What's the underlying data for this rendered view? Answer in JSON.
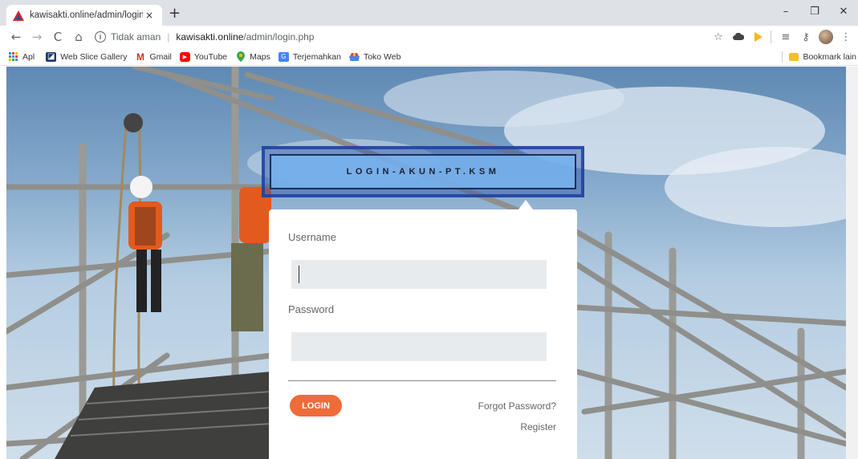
{
  "browser": {
    "tab_title": "kawisakti.online/admin/login.php",
    "tab_close": "×",
    "new_tab": "+",
    "window": {
      "minimize": "–",
      "maximize": "❐",
      "close": "✕"
    },
    "nav": {
      "back": "←",
      "forward": "→",
      "reload": "C",
      "home": "⌂"
    },
    "security_info": "i",
    "security_label": "Tidak aman",
    "url_host": "kawisakti.online",
    "url_path": "/admin/login.php",
    "bookmarks": [
      {
        "label": "Apl",
        "icon": "apps-grid-icon"
      },
      {
        "label": "Web Slice Gallery",
        "icon": "web-slice-icon"
      },
      {
        "label": "Gmail",
        "icon": "gmail-icon"
      },
      {
        "label": "YouTube",
        "icon": "youtube-icon"
      },
      {
        "label": "Maps",
        "icon": "maps-pin-icon"
      },
      {
        "label": "Terjemahkan",
        "icon": "translate-icon"
      },
      {
        "label": "Toko Web",
        "icon": "webstore-icon"
      }
    ],
    "bookmark_other": "Bookmark lain"
  },
  "page": {
    "banner_title": "LOGIN-AKUN-PT.KSM",
    "form": {
      "username_label": "Username",
      "username_value": "",
      "password_label": "Password",
      "password_value": "",
      "login_button": "LOGIN",
      "forgot_link": "Forgot Password?",
      "register_link": "Register"
    }
  },
  "colors": {
    "accent": "#ef6c3a",
    "banner": "#78b4f0",
    "input_bg": "#e8ebee"
  }
}
